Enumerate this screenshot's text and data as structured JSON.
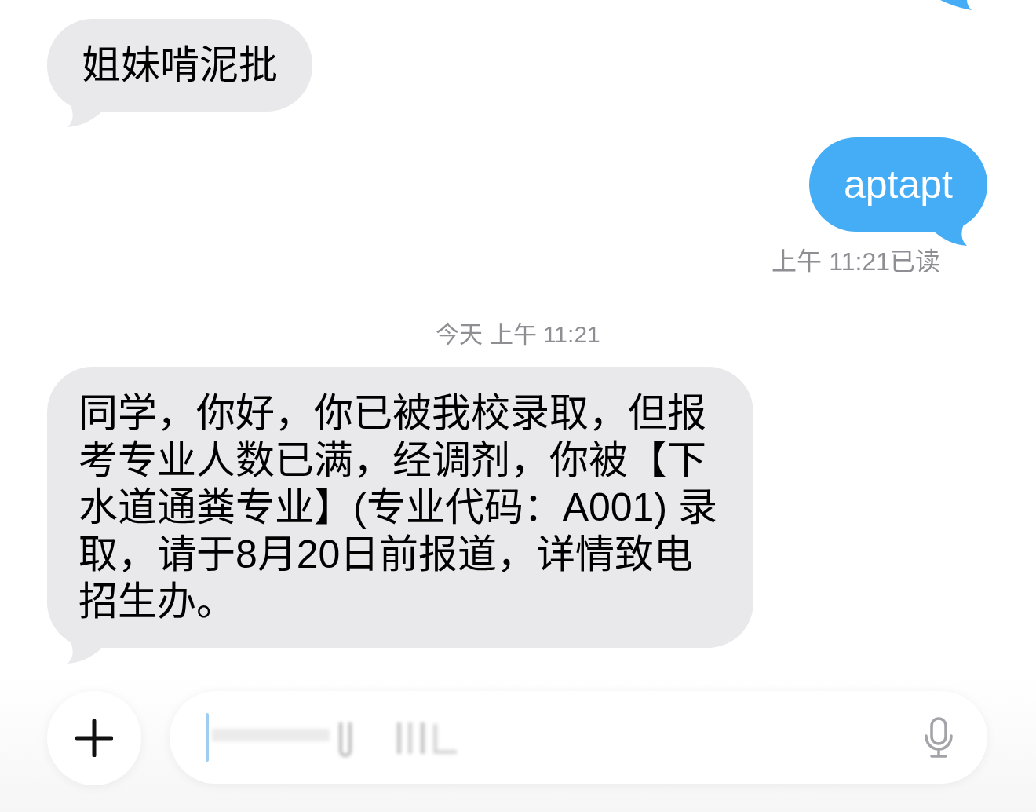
{
  "conversation": {
    "partial_sent_bubble_above": true,
    "messages": [
      {
        "kind": "received",
        "text": "姐妹啃泥批"
      },
      {
        "kind": "sent",
        "text": "aptapt",
        "receipt": "上午 11:21已读"
      },
      {
        "kind": "timestamp",
        "text": "今天 上午 11:21"
      },
      {
        "kind": "received",
        "text": "同学，你好，你已被我校录取，但报考专业人数已满，经调剂，你被【下水道通粪专业】(专业代码：A001) 录取，请于8月20日前报道，详情致电招生办。"
      }
    ]
  },
  "composer": {
    "cursor": true,
    "blurred_text": true
  }
}
